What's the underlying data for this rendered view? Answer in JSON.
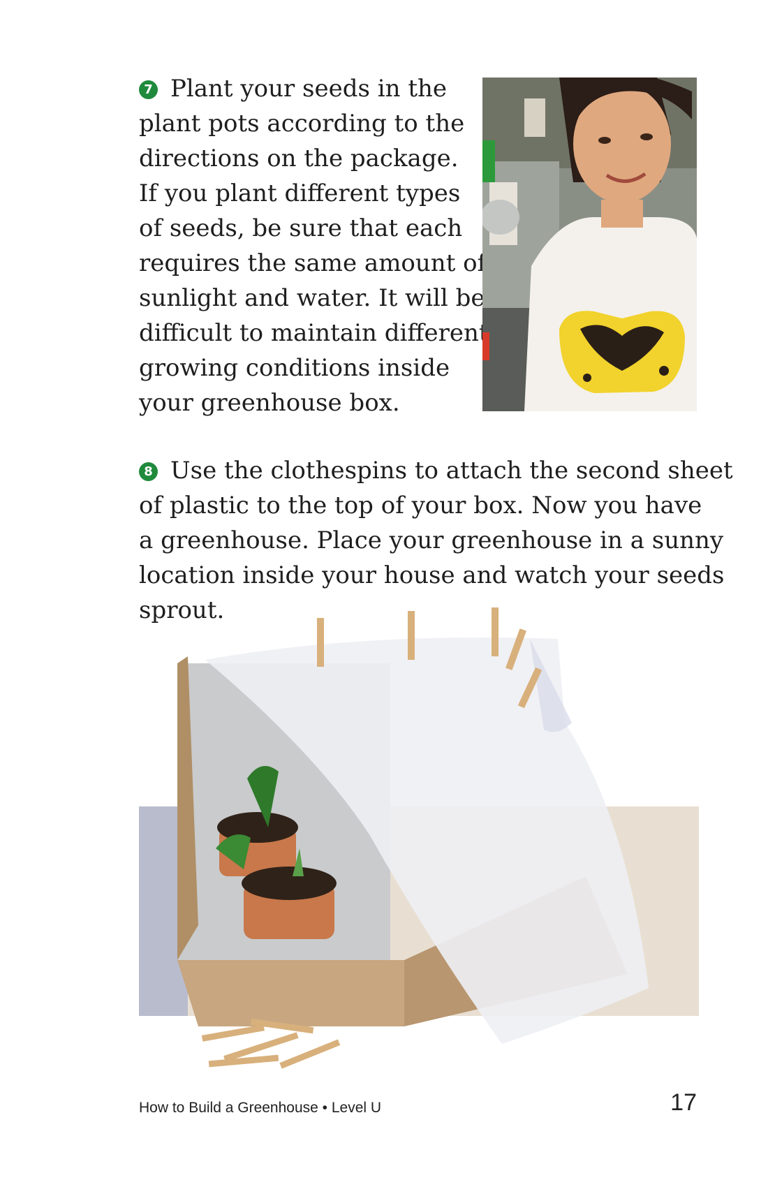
{
  "step7": {
    "number": "7",
    "lines": [
      "Plant your seeds in the",
      "plant pots according to the",
      "directions on the package.",
      "If you plant different types",
      "of seeds, be sure that each",
      "requires the same amount of",
      "sunlight and water. It will be",
      "difficult to maintain different",
      "growing conditions inside",
      "your greenhouse box."
    ]
  },
  "step8": {
    "number": "8",
    "lines": [
      "Use the clothespins to attach the second sheet",
      "of plastic to the top of your box. Now you have",
      "a greenhouse. Place your greenhouse in a sunny",
      "location inside your house and watch your seeds",
      "sprout."
    ]
  },
  "footer": {
    "book_title": "How to Build a Greenhouse • Level U",
    "page_number": "17"
  },
  "colors": {
    "badge": "#1f8a3c",
    "glove": "#f2d22c",
    "pot": "#c8784a"
  }
}
